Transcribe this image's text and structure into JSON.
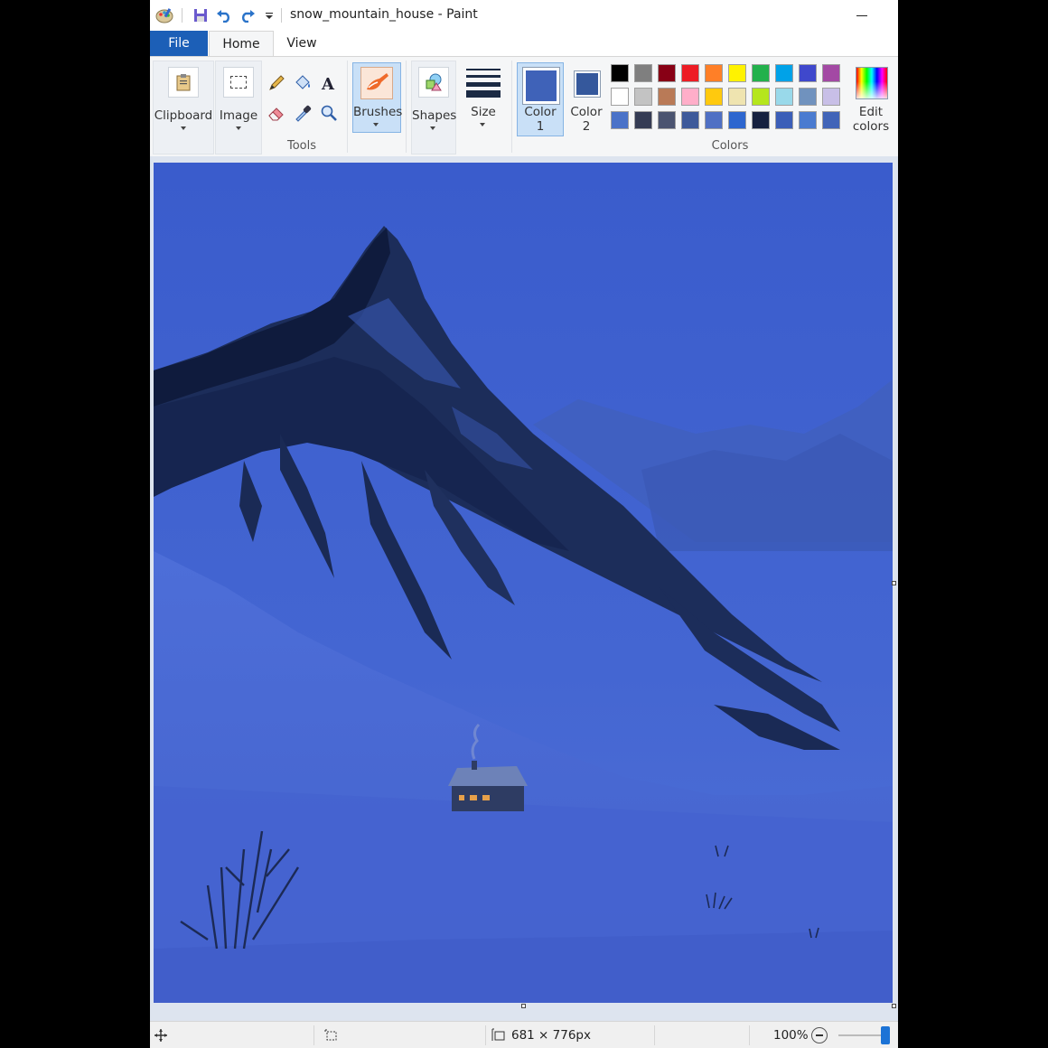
{
  "window": {
    "title": "snow_mountain_house - Paint"
  },
  "tabs": {
    "file": "File",
    "home": "Home",
    "view": "View"
  },
  "ribbon": {
    "clipboard": "Clipboard",
    "image": "Image",
    "tools_group": "Tools",
    "brushes": "Brushes",
    "shapes": "Shapes",
    "size": "Size",
    "color1_line1": "Color",
    "color1_line2": "1",
    "color2_line1": "Color",
    "color2_line2": "2",
    "edit_line1": "Edit",
    "edit_line2": "colors",
    "colors_group": "Colors",
    "color1_value": "#3f62b8",
    "color2_value": "#35589c",
    "palette": [
      "#000000",
      "#7f7f7f",
      "#880015",
      "#ed1c24",
      "#ff7f27",
      "#fff200",
      "#22b14c",
      "#00a2e8",
      "#3f48cc",
      "#a349a4",
      "#ffffff",
      "#c3c3c3",
      "#b97a57",
      "#ffaec9",
      "#ffc90e",
      "#efe4b0",
      "#b5e61d",
      "#99d9ea",
      "#7092be",
      "#c8bfe7",
      "#4a72c8",
      "#353c54",
      "#4b5470",
      "#3e5a9a",
      "#4f70c4",
      "#2d66cf",
      "#16213f",
      "#3b5eb8",
      "#4a7bd0",
      "#4164b8"
    ]
  },
  "status": {
    "dimensions": "681 × 776px",
    "zoom": "100%"
  }
}
